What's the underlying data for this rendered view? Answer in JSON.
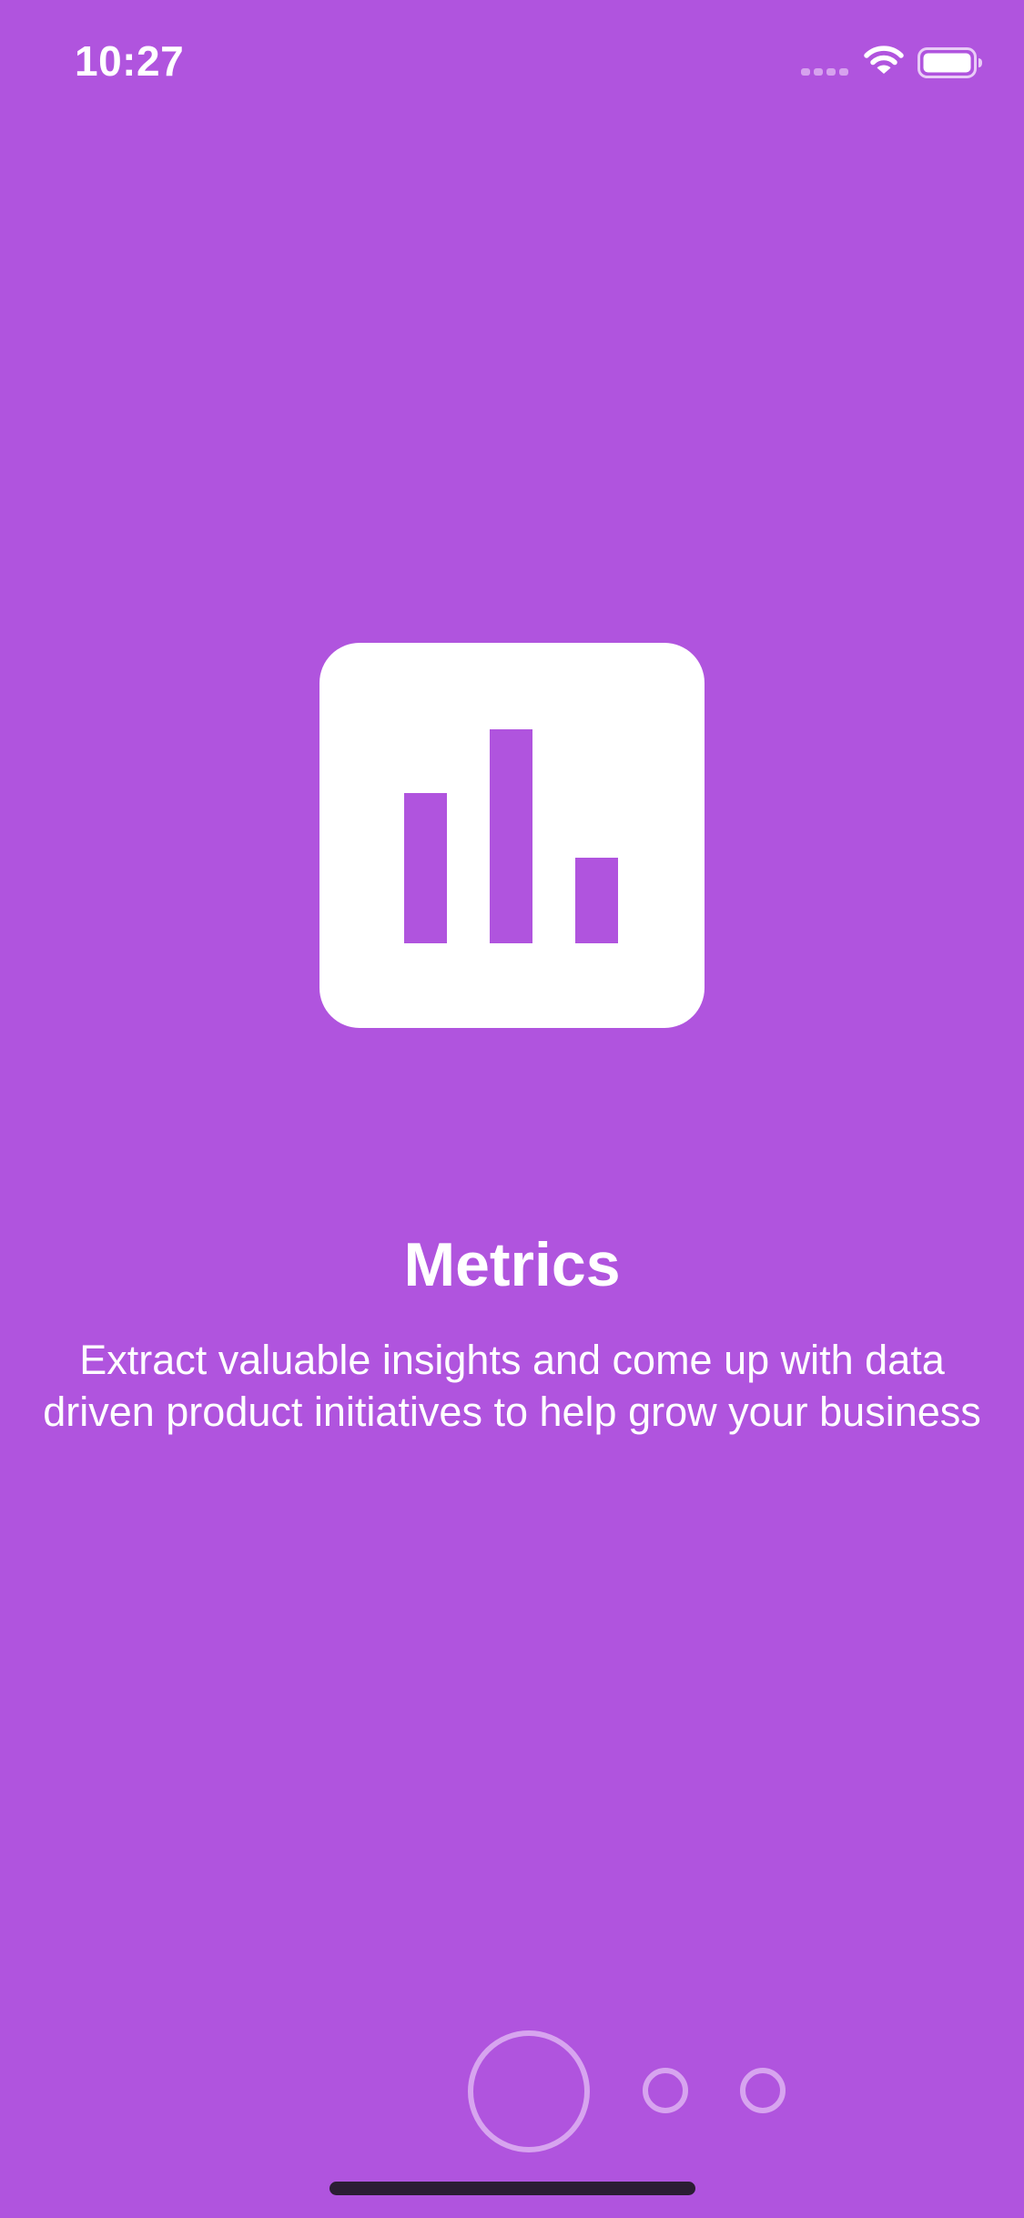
{
  "theme": {
    "background": "#B054DE",
    "foreground": "#FFFFFF",
    "dot_color": "#D7A4EF",
    "home_indicator": "#2B1D33"
  },
  "status_bar": {
    "time": "10:27",
    "icons": [
      "signal-icon",
      "wifi-icon",
      "battery-icon"
    ]
  },
  "onboarding": {
    "icon": "bar-chart-icon",
    "chart_bars_relative_heights": [
      0.7,
      1.0,
      0.4
    ],
    "title": "Metrics",
    "description": "Extract valuable insights and come up with data driven product initiatives to help grow your business"
  },
  "pager": {
    "page_count": 3,
    "active_page": 1
  }
}
